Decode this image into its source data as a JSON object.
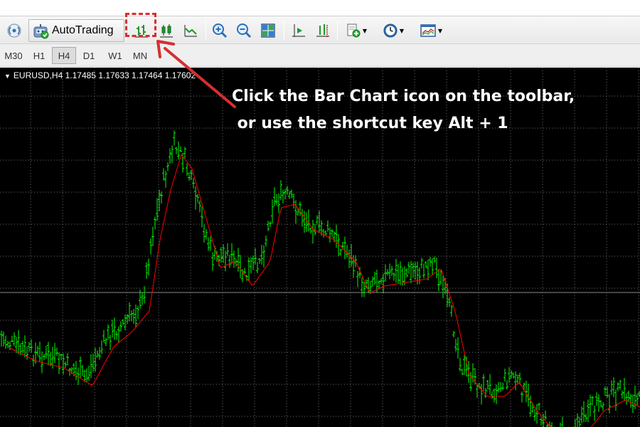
{
  "toolbar": {
    "autotrading_label": "AutoTrading",
    "buttons": [
      {
        "name": "signal-icon"
      },
      {
        "name": "bar-chart-icon"
      },
      {
        "name": "candlestick-chart-icon"
      },
      {
        "name": "line-chart-icon"
      },
      {
        "name": "zoom-in-icon"
      },
      {
        "name": "zoom-out-icon"
      },
      {
        "name": "tile-windows-icon"
      },
      {
        "name": "chart-shift-icon"
      },
      {
        "name": "auto-scroll-icon"
      },
      {
        "name": "indicators-icon"
      },
      {
        "name": "periods-icon"
      },
      {
        "name": "templates-icon"
      }
    ]
  },
  "timeframes": {
    "items": [
      "M30",
      "H1",
      "H4",
      "D1",
      "W1",
      "MN"
    ],
    "active": "H4"
  },
  "chart": {
    "header_text": "EURUSD,H4  1.17485 1.17633 1.17464 1.17602",
    "bar_color": "#00ff00",
    "ma_color": "#ff0000",
    "grid_color": "#6e6e6e",
    "background": "#000000"
  },
  "callout": {
    "line1": "Click the Bar Chart icon on the toolbar,",
    "line2": " or use the shortcut key Alt + 1",
    "color": "#ffffff",
    "arrow_color": "#d62f2f"
  }
}
